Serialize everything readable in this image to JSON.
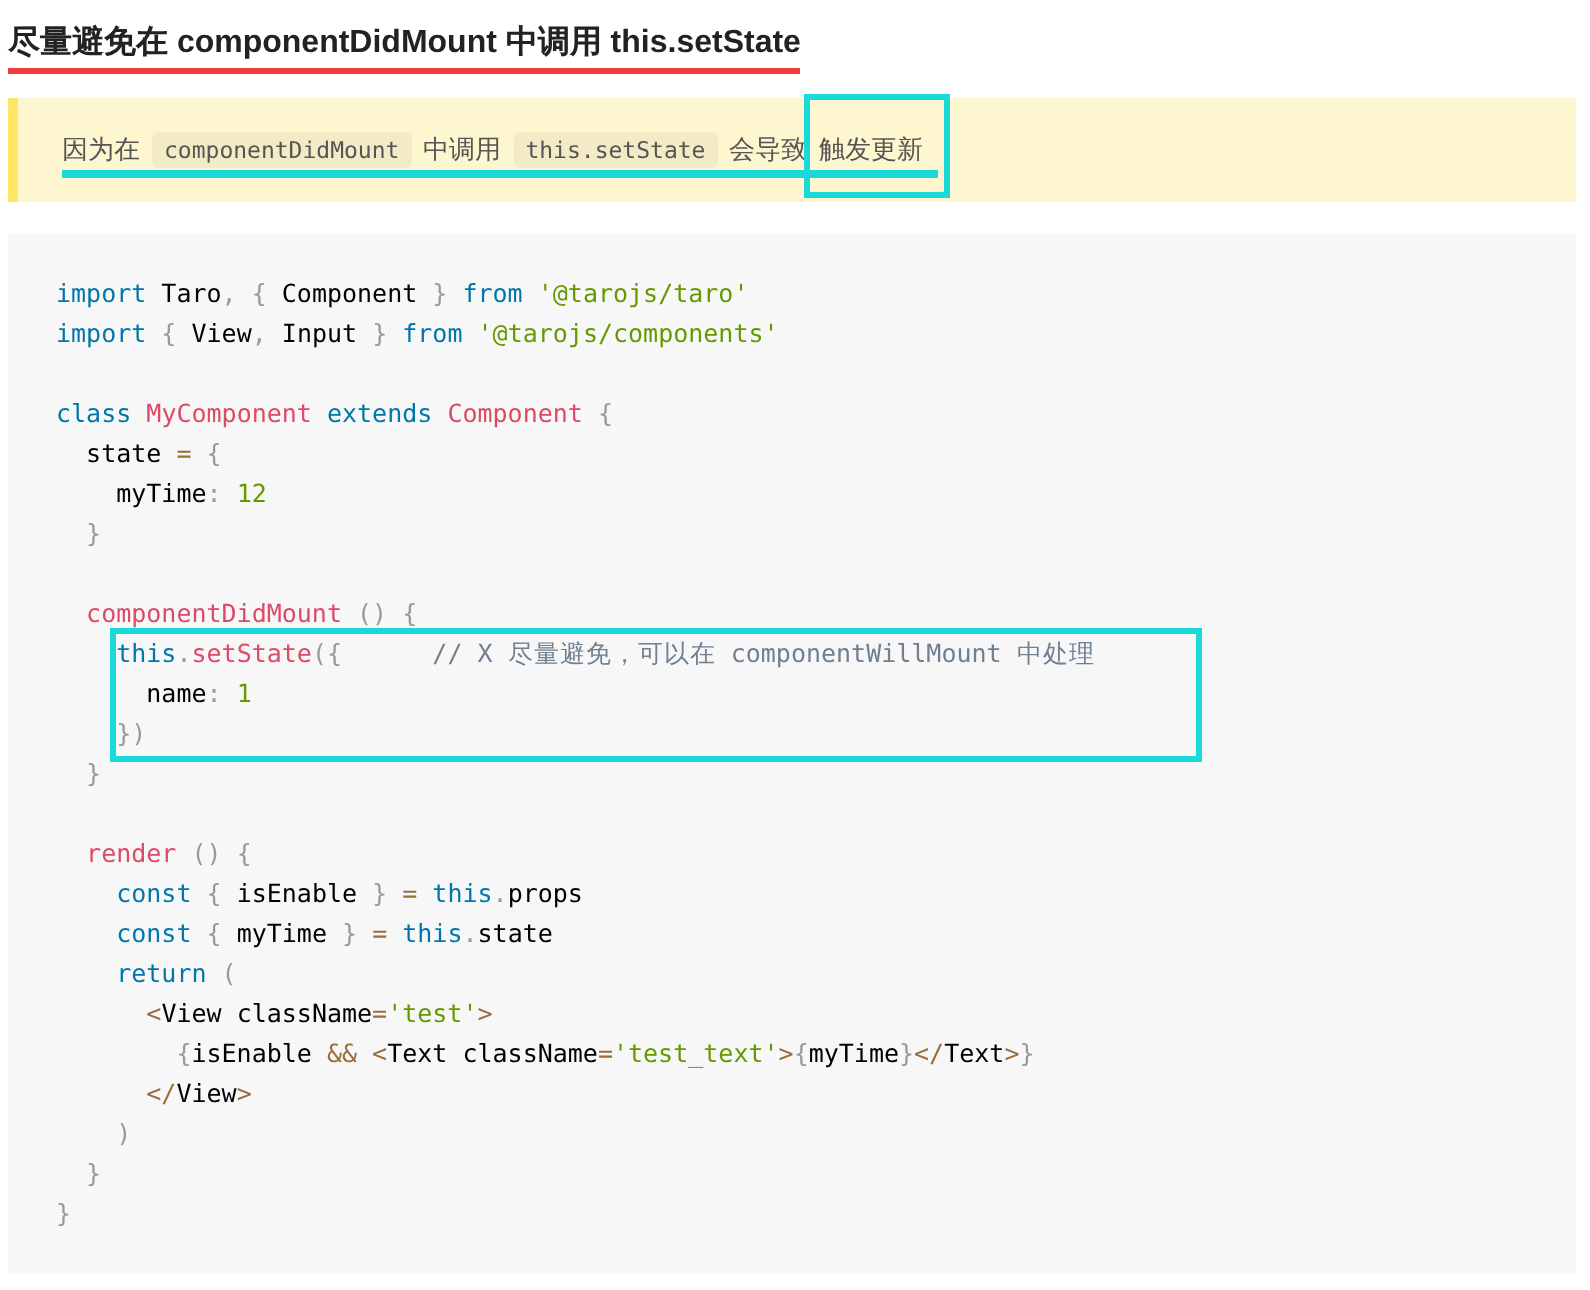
{
  "heading": {
    "text": "尽量避免在 componentDidMount 中调用 this.setState",
    "underlined": true
  },
  "note": {
    "underlined": true,
    "segments": [
      {
        "kind": "text",
        "text": "因为在"
      },
      {
        "kind": "code",
        "text": "componentDidMount"
      },
      {
        "kind": "text",
        "text": "中调用"
      },
      {
        "kind": "code",
        "text": "this.setState"
      },
      {
        "kind": "text",
        "text": "会导致"
      },
      {
        "kind": "boxed",
        "text": "触发更新"
      }
    ]
  },
  "code": {
    "blocks": [
      {
        "kind": "plain",
        "lines": [
          {
            "kind": "code",
            "tokens": [
              {
                "kind": "kw",
                "text": "import"
              },
              {
                "kind": "plain",
                "text": " Taro"
              },
              {
                "kind": "punct",
                "text": ", {"
              },
              {
                "kind": "plain",
                "text": " Component"
              },
              {
                "kind": "punct",
                "text": " }"
              },
              {
                "kind": "kw",
                "text": " from"
              },
              {
                "kind": "str",
                "text": " '@tarojs/taro'"
              }
            ]
          },
          {
            "kind": "code",
            "tokens": [
              {
                "kind": "kw",
                "text": "import"
              },
              {
                "kind": "punct",
                "text": " {"
              },
              {
                "kind": "plain",
                "text": " View"
              },
              {
                "kind": "punct",
                "text": ","
              },
              {
                "kind": "plain",
                "text": " Input"
              },
              {
                "kind": "punct",
                "text": " }"
              },
              {
                "kind": "kw",
                "text": " from"
              },
              {
                "kind": "str",
                "text": " '@tarojs/components'"
              }
            ]
          },
          {
            "kind": "blank"
          },
          {
            "kind": "code",
            "tokens": [
              {
                "kind": "kw",
                "text": "class"
              },
              {
                "kind": "fn",
                "text": " MyComponent"
              },
              {
                "kind": "kw",
                "text": " extends"
              },
              {
                "kind": "fn",
                "text": " Component"
              },
              {
                "kind": "punct",
                "text": " {"
              }
            ]
          },
          {
            "kind": "code",
            "tokens": [
              {
                "kind": "plain",
                "text": "  state"
              },
              {
                "kind": "op",
                "text": " ="
              },
              {
                "kind": "punct",
                "text": " {"
              }
            ]
          },
          {
            "kind": "code",
            "tokens": [
              {
                "kind": "plain",
                "text": "    myTime"
              },
              {
                "kind": "punct",
                "text": ":"
              },
              {
                "kind": "num",
                "text": " 12"
              }
            ]
          },
          {
            "kind": "code",
            "tokens": [
              {
                "kind": "punct",
                "text": "  }"
              }
            ]
          },
          {
            "kind": "blank"
          },
          {
            "kind": "code",
            "tokens": [
              {
                "kind": "fn",
                "text": "  componentDidMount"
              },
              {
                "kind": "punct",
                "text": " () {"
              }
            ]
          }
        ]
      },
      {
        "kind": "boxed",
        "lines": [
          {
            "kind": "code",
            "tokens": [
              {
                "kind": "kw",
                "text": "    this"
              },
              {
                "kind": "punct",
                "text": "."
              },
              {
                "kind": "fn",
                "text": "setState"
              },
              {
                "kind": "punct",
                "text": "({"
              },
              {
                "kind": "comment",
                "text": "      // X 尽量避免，可以在 componentWillMount 中处理"
              }
            ]
          },
          {
            "kind": "code",
            "tokens": [
              {
                "kind": "plain",
                "text": "      name"
              },
              {
                "kind": "punct",
                "text": ":"
              },
              {
                "kind": "num",
                "text": " 1"
              }
            ]
          },
          {
            "kind": "code",
            "tokens": [
              {
                "kind": "punct",
                "text": "    })"
              }
            ]
          }
        ]
      },
      {
        "kind": "plain",
        "lines": [
          {
            "kind": "code",
            "tokens": [
              {
                "kind": "punct",
                "text": "  }"
              }
            ]
          },
          {
            "kind": "blank"
          },
          {
            "kind": "code",
            "tokens": [
              {
                "kind": "fn",
                "text": "  render"
              },
              {
                "kind": "punct",
                "text": " () {"
              }
            ]
          },
          {
            "kind": "code",
            "tokens": [
              {
                "kind": "kw",
                "text": "    const"
              },
              {
                "kind": "punct",
                "text": " {"
              },
              {
                "kind": "plain",
                "text": " isEnable"
              },
              {
                "kind": "punct",
                "text": " }"
              },
              {
                "kind": "op",
                "text": " ="
              },
              {
                "kind": "kw",
                "text": " this"
              },
              {
                "kind": "punct",
                "text": "."
              },
              {
                "kind": "plain",
                "text": "props"
              }
            ]
          },
          {
            "kind": "code",
            "tokens": [
              {
                "kind": "kw",
                "text": "    const"
              },
              {
                "kind": "punct",
                "text": " {"
              },
              {
                "kind": "plain",
                "text": " myTime"
              },
              {
                "kind": "punct",
                "text": " }"
              },
              {
                "kind": "op",
                "text": " ="
              },
              {
                "kind": "kw",
                "text": " this"
              },
              {
                "kind": "punct",
                "text": "."
              },
              {
                "kind": "plain",
                "text": "state"
              }
            ]
          },
          {
            "kind": "code",
            "tokens": [
              {
                "kind": "kw",
                "text": "    return"
              },
              {
                "kind": "punct",
                "text": " ("
              }
            ]
          },
          {
            "kind": "code",
            "tokens": [
              {
                "kind": "op",
                "text": "      <"
              },
              {
                "kind": "plain",
                "text": "View className"
              },
              {
                "kind": "op",
                "text": "="
              },
              {
                "kind": "str",
                "text": "'test'"
              },
              {
                "kind": "op",
                "text": ">"
              }
            ]
          },
          {
            "kind": "code",
            "tokens": [
              {
                "kind": "punct",
                "text": "        {"
              },
              {
                "kind": "plain",
                "text": "isEnable"
              },
              {
                "kind": "op",
                "text": " && <"
              },
              {
                "kind": "plain",
                "text": "Text className"
              },
              {
                "kind": "op",
                "text": "="
              },
              {
                "kind": "str",
                "text": "'test_text'"
              },
              {
                "kind": "op",
                "text": ">"
              },
              {
                "kind": "punct",
                "text": "{"
              },
              {
                "kind": "plain",
                "text": "myTime"
              },
              {
                "kind": "punct",
                "text": "}"
              },
              {
                "kind": "op",
                "text": "</"
              },
              {
                "kind": "plain",
                "text": "Text"
              },
              {
                "kind": "op",
                "text": ">"
              },
              {
                "kind": "punct",
                "text": "}"
              }
            ]
          },
          {
            "kind": "code",
            "tokens": [
              {
                "kind": "op",
                "text": "      </"
              },
              {
                "kind": "plain",
                "text": "View"
              },
              {
                "kind": "op",
                "text": ">"
              }
            ]
          },
          {
            "kind": "code",
            "tokens": [
              {
                "kind": "punct",
                "text": "    )"
              }
            ]
          },
          {
            "kind": "code",
            "tokens": [
              {
                "kind": "punct",
                "text": "  }"
              }
            ]
          },
          {
            "kind": "code",
            "tokens": [
              {
                "kind": "punct",
                "text": "}"
              }
            ]
          }
        ]
      }
    ]
  }
}
